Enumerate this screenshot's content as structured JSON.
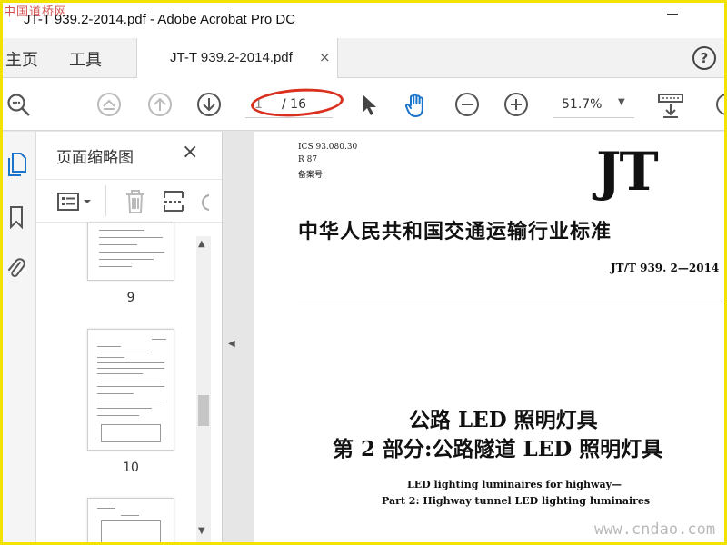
{
  "app": {
    "watermark_logo": "中国道桥网",
    "window_title": "JT-T 939.2-2014.pdf - Adobe Acrobat Pro DC"
  },
  "tabs": {
    "home_label": "主页",
    "tools_label": "工具",
    "document_tab_label": "JT-T 939.2-2014.pdf",
    "close_glyph": "×"
  },
  "toolbar": {
    "current_page": "1",
    "total_pages": "/ 16",
    "zoom_level": "51.7%",
    "annotation_color": "#d9301f",
    "accent_color": "#1b74c9"
  },
  "sidebar": {
    "panel_title": "页面缩略图",
    "close_glyph": "×",
    "thumbnails": [
      {
        "label": "9"
      },
      {
        "label": "10"
      }
    ]
  },
  "document": {
    "ics": "ICS 93.080.30",
    "r_code": "R 87",
    "record_no": "备案号:",
    "logo": "JT",
    "standard_title": "中华人民共和国交通运输行业标准",
    "standard_code": "JT/T 939. 2—2014",
    "title_cn_1": "公路 LED 照明灯具",
    "title_cn_2": "第 2 部分:公路隧道 LED 照明灯具",
    "title_en_1": "LED lighting luminaires for highway—",
    "title_en_2": "Part 2: Highway tunnel LED lighting luminaires",
    "site_watermark": "www.cndao.com"
  }
}
